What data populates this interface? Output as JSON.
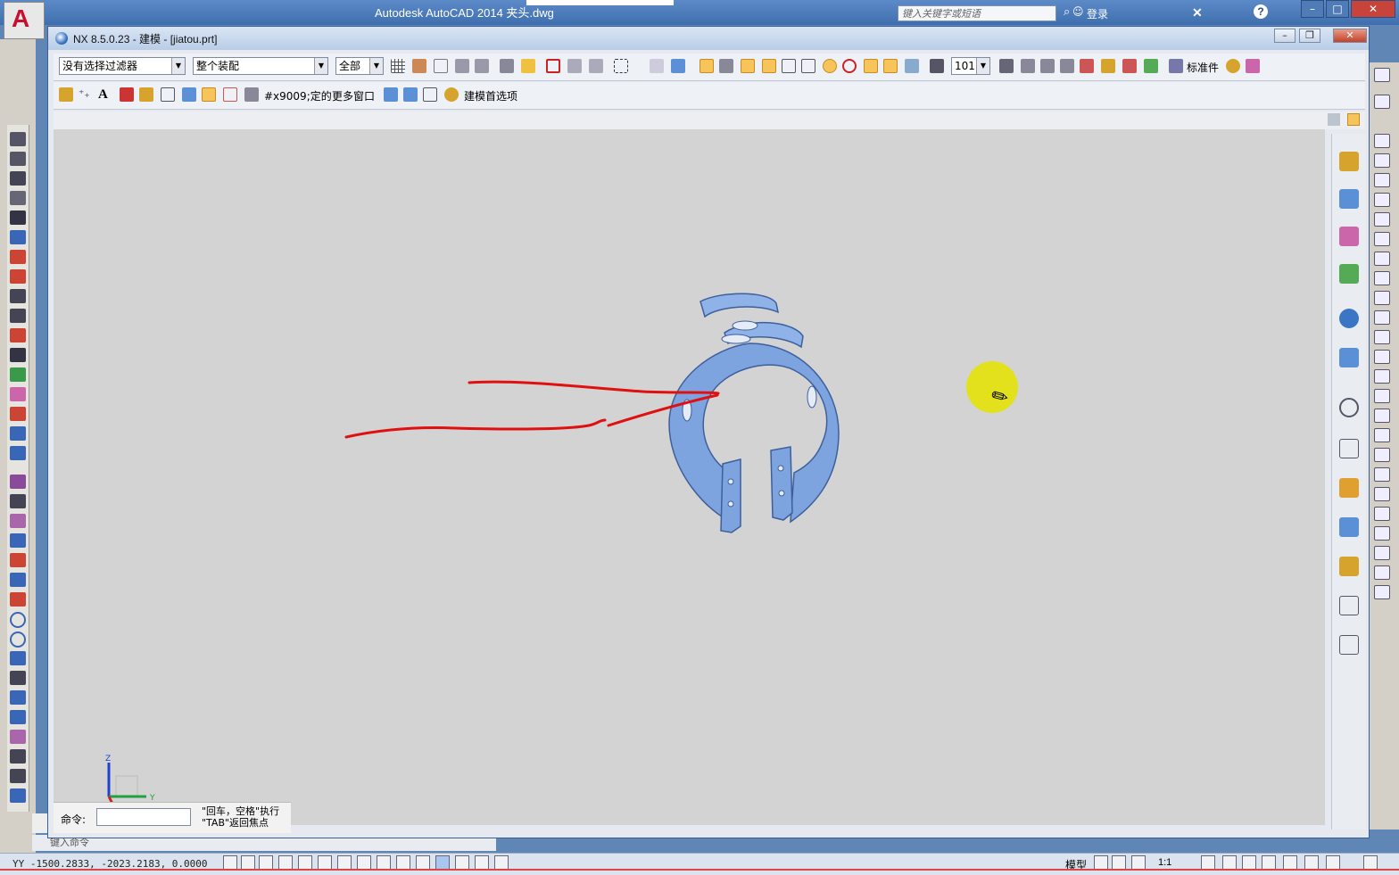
{
  "acad": {
    "title": "Autodesk AutoCAD 2014      夹头.dwg",
    "search_placeholder": "键入关键字或短语",
    "login": "登录",
    "coords": "YY  -1500.2833, -2023.2183, 0.0000",
    "model_label": "模型",
    "scale": "1:1",
    "cmd_placeholder": "键入命令"
  },
  "nx": {
    "title": "NX 8.5.0.23 - 建模 - [jiatou.prt]",
    "filter_value": "没有选择过滤器",
    "assembly_value": "整个装配",
    "scope_value": "全部",
    "layer_value": "101",
    "standard_parts": "标准件",
    "snap_text": "#x9009;定的",
    "more_windows": "更多窗口",
    "prefs": "建模首选项",
    "cmd_label": "命令:",
    "cmd_hint_1": "\"回车，空格\"执行",
    "cmd_hint_2": "\"TAB\"返回焦点"
  },
  "colors": {
    "part_blue": "#7ea4e0",
    "annotation_red": "#e01010",
    "cursor_halo": "#e2e11c",
    "accent_orange": "#f6c45a"
  }
}
